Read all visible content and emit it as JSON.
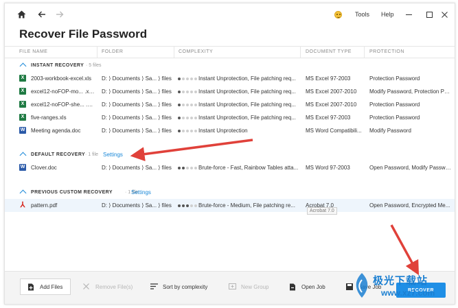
{
  "window": {
    "title": "Recover File Password",
    "menu": [
      "Tools",
      "Help"
    ]
  },
  "columns": [
    "FILE NAME",
    "FOLDER",
    "COMPLEXITY",
    "DOCUMENT TYPE",
    "PROTECTION"
  ],
  "groups": [
    {
      "title": "INSTANT RECOVERY",
      "count": "· 5 files",
      "link": "",
      "rows": [
        {
          "icon": "xls",
          "name": "2003-workbook-excel.xls",
          "folder": "D: ⟩ Documents ⟩ Sa... ⟩ files",
          "level": 1,
          "complexity": "Instant Unprotection, File patching req...",
          "type": "MS Excel 97-2003",
          "protection": "Protection Password"
        },
        {
          "icon": "xls",
          "name": "excel12-noFOP-mo... .xlsx",
          "folder": "D: ⟩ Documents ⟩ Sa... ⟩ files",
          "level": 1,
          "complexity": "Instant Unprotection, File patching req...",
          "type": "MS Excel 2007-2010",
          "protection": "Modify Password, Protection Pa..."
        },
        {
          "icon": "xls",
          "name": "excel12-noFOP-she... .xlsx",
          "folder": "D: ⟩ Documents ⟩ Sa... ⟩ files",
          "level": 1,
          "complexity": "Instant Unprotection, File patching req...",
          "type": "MS Excel 2007-2010",
          "protection": "Protection Password"
        },
        {
          "icon": "xls",
          "name": "five-ranges.xls",
          "folder": "D: ⟩ Documents ⟩ Sa... ⟩ files",
          "level": 1,
          "complexity": "Instant Unprotection, File patching req...",
          "type": "MS Excel 97-2003",
          "protection": "Protection Password"
        },
        {
          "icon": "doc",
          "name": "Meeting agenda.doc",
          "folder": "D: ⟩ Documents ⟩ Sa... ⟩ files",
          "level": 1,
          "complexity": "Instant Unprotection",
          "type": "MS Word Compatibili...",
          "protection": "Modify Password"
        }
      ]
    },
    {
      "title": "DEFAULT RECOVERY",
      "count": "· 1 file",
      "link": "Settings",
      "rows": [
        {
          "icon": "doc",
          "name": "Clover.doc",
          "folder": "D: ⟩ Documents ⟩ Sa... ⟩ files",
          "level": 2,
          "complexity": "Brute-force - Fast, Rainbow Tables atta...",
          "type": "MS Word 97-2003",
          "protection": "Open Password, Modify Passwo..."
        }
      ]
    },
    {
      "title": "PREVIOUS CUSTOM RECOVERY",
      "count": "· 1 file",
      "link": "Settings",
      "rows": [
        {
          "icon": "pdf",
          "name": "pattern.pdf",
          "folder": "D: ⟩ Documents ⟩ Sa... ⟩ files",
          "level": 3,
          "complexity": "Brute-force - Medium, File patching re...",
          "type": "Acrobat 7.0",
          "protection": "Open Password, Encrypted Me..."
        }
      ]
    }
  ],
  "tooltip": "Acrobat 7.0",
  "toolbar": {
    "add_files": "Add Files",
    "remove_files": "Remove File(s)",
    "sort": "Sort by complexity",
    "new_group": "New Group",
    "open_job": "Open Job",
    "save_job": "Save Job",
    "recover": "RECOVER"
  },
  "watermark": {
    "line1": "极光下载站",
    "line2": "www.xz7.com"
  },
  "colors": {
    "accent": "#1a88d8",
    "recover_button": "#1f8fe6",
    "annotation_arrow": "#e0413a",
    "excel": "#1f7a43",
    "word": "#2b5aa8",
    "pdf": "#d6261d"
  },
  "icons": {
    "home": "home-icon",
    "back": "arrow-left-icon",
    "forward": "arrow-right-icon",
    "emoji": "smiley-icon",
    "minimize": "minimize-icon",
    "maximize": "maximize-icon",
    "close": "close-icon"
  }
}
